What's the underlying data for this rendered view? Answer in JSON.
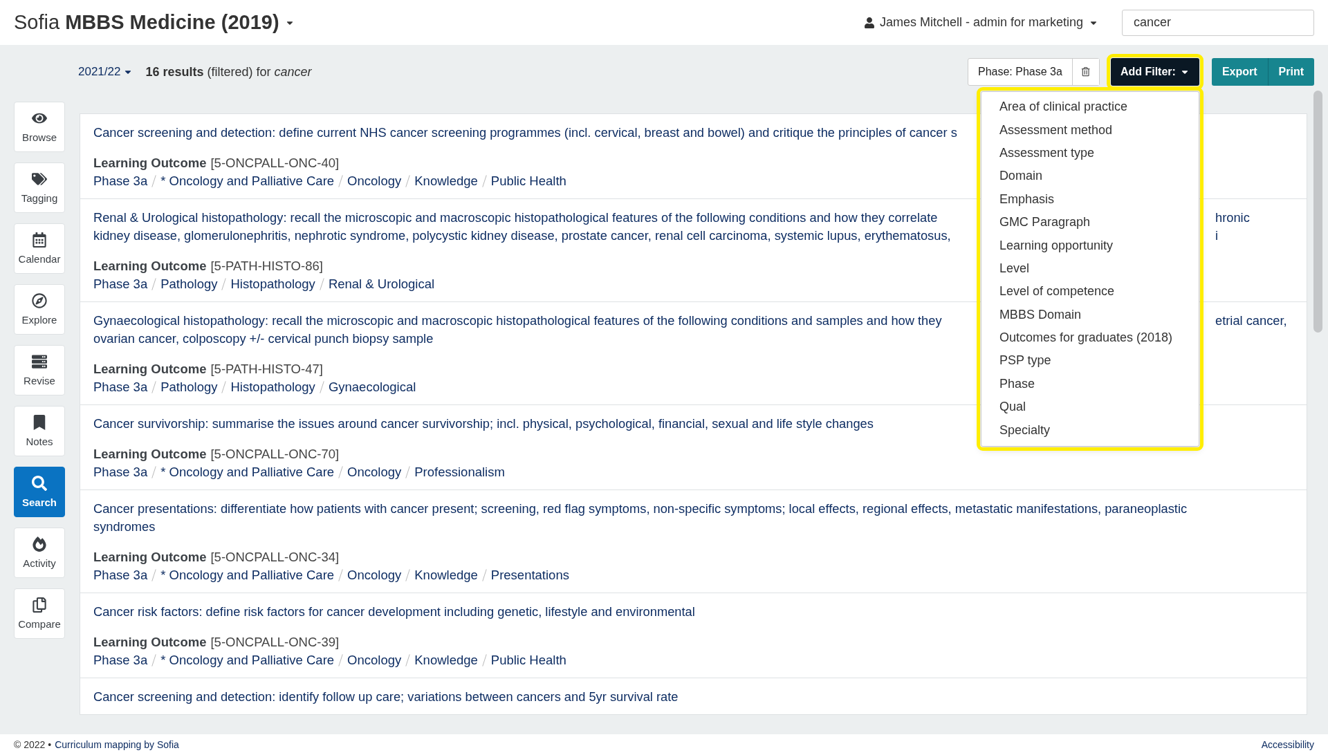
{
  "header": {
    "title": "Sofia **MBBS Medicine (2019)**",
    "user": "James Mitchell - admin for marketing",
    "search": {
      "value": "cancer"
    }
  },
  "toolbar": {
    "year": "2021/22",
    "summary": "**16 results** (filtered) for *cancer*",
    "filter_chip": "Phase: Phase 3a",
    "add_filter": "Add Filter:",
    "buttons": [
      "Export",
      "Print"
    ]
  },
  "filter_menu": {
    "items": [
      "Area of clinical practice",
      "Assessment method",
      "Assessment type",
      "Domain",
      "Emphasis",
      "GMC Paragraph",
      "Learning opportunity",
      "Level",
      "Level of competence",
      "MBBS Domain",
      "Outcomes for graduates (2018)",
      "PSP type",
      "Phase",
      "Qual",
      "Specialty"
    ]
  },
  "sidebar": {
    "items": [
      {
        "kind": "browse",
        "label": "Browse",
        "selected": false
      },
      {
        "kind": "tagging",
        "label": "Tagging",
        "selected": false
      },
      {
        "kind": "calendar",
        "label": "Calendar",
        "selected": false
      },
      {
        "kind": "explore",
        "label": "Explore",
        "selected": false
      },
      {
        "kind": "revise",
        "label": "Revise",
        "selected": false
      },
      {
        "kind": "notes",
        "label": "Notes",
        "selected": false
      },
      {
        "kind": "search",
        "label": "Search",
        "selected": true
      },
      {
        "kind": "activity",
        "label": "Activity",
        "selected": false
      },
      {
        "kind": "compare",
        "label": "Compare",
        "selected": false
      }
    ]
  },
  "results": [
    {
      "title_lines": [
        {
          "left": "Cancer screening and detection: define current NHS cancer screening programmes (incl. cervical, breast and bowel) and critique the principles of cancer s"
        }
      ],
      "type": "Learning Outcome",
      "code": "[5-ONCPALL-ONC-40]",
      "tags": [
        "Phase 3a",
        "* Oncology and Palliative Care",
        "Oncology",
        "Knowledge",
        "Public Health"
      ]
    },
    {
      "title_lines": [
        {
          "left": "Renal & Urological histopathology: recall the microscopic and macroscopic histopathological features of the following conditions and how they correlate",
          "right": "hronic"
        },
        {
          "left": "kidney disease, glomerulonephritis, nephrotic syndrome, polycystic kidney disease, prostate cancer, renal cell carcinoma, systemic lupus, erythematosus,",
          "right": "i"
        }
      ],
      "type": "Learning Outcome",
      "code": "[5-PATH-HISTO-86]",
      "tags": [
        "Phase 3a",
        "Pathology",
        "Histopathology",
        "Renal & Urological"
      ]
    },
    {
      "title_lines": [
        {
          "left": "Gynaecological histopathology: recall the microscopic and macroscopic histopathological features of the following conditions and samples and how they",
          "right": "etrial cancer,"
        },
        {
          "left": "ovarian cancer, colposcopy +/- cervical punch biopsy sample"
        }
      ],
      "type": "Learning Outcome",
      "code": "[5-PATH-HISTO-47]",
      "tags": [
        "Phase 3a",
        "Pathology",
        "Histopathology",
        "Gynaecological"
      ]
    },
    {
      "title_lines": [
        {
          "left": "Cancer survivorship: summarise the issues around cancer survivorship; incl. physical, psychological, financial, sexual and life style changes"
        }
      ],
      "type": "Learning Outcome",
      "code": "[5-ONCPALL-ONC-70]",
      "tags": [
        "Phase 3a",
        "* Oncology and Palliative Care",
        "Oncology",
        "Professionalism"
      ]
    },
    {
      "title_lines": [
        {
          "left": "Cancer presentations: differentiate how patients with cancer present; screening, red flag symptoms, non-specific symptoms; local effects, regional effects, metastatic manifestations, paraneoplastic"
        },
        {
          "left": "syndromes"
        }
      ],
      "type": "Learning Outcome",
      "code": "[5-ONCPALL-ONC-34]",
      "tags": [
        "Phase 3a",
        "* Oncology and Palliative Care",
        "Oncology",
        "Knowledge",
        "Presentations"
      ]
    },
    {
      "title_lines": [
        {
          "left": "Cancer risk factors: define risk factors for cancer development including genetic, lifestyle and environmental"
        }
      ],
      "type": "Learning Outcome",
      "code": "[5-ONCPALL-ONC-39]",
      "tags": [
        "Phase 3a",
        "* Oncology and Palliative Care",
        "Oncology",
        "Knowledge",
        "Public Health"
      ]
    },
    {
      "title_lines": [
        {
          "left": "Cancer screening and detection: identify follow up care; variations between cancers and 5yr survival rate"
        }
      ]
    }
  ],
  "footer": {
    "copyright": "© 2022 •",
    "link": "Curriculum mapping by Sofia",
    "accessibility": "Accessibility"
  }
}
